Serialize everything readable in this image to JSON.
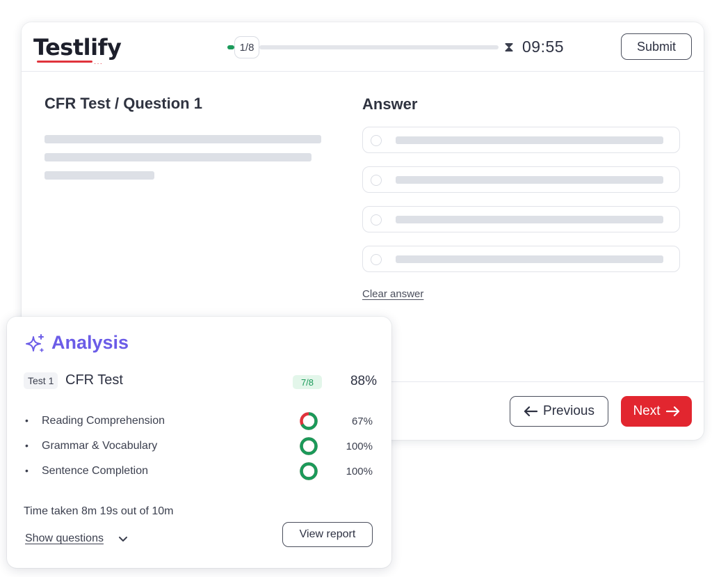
{
  "header": {
    "logo_text": "Testlify",
    "logo_dots": "···",
    "progress_label": "1/8",
    "progress_fraction": 0.0,
    "timer": "09:55",
    "timer_icon": "hourglass-icon",
    "submit_label": "Submit"
  },
  "question": {
    "title": "CFR Test / Question 1"
  },
  "answer": {
    "title": "Answer",
    "option_count": 4,
    "clear_label": "Clear answer"
  },
  "nav": {
    "previous_label": "Previous",
    "next_label": "Next",
    "previous_icon": "arrow-left-icon",
    "next_icon": "arrow-right-icon"
  },
  "analysis": {
    "title": "Analysis",
    "icon": "sparkle-icon",
    "test_tag": "Test 1",
    "test_name": "CFR Test",
    "score_badge": "7/8",
    "score_pct": "88%",
    "sections": [
      {
        "name": "Reading Comprehension",
        "pct_label": "67%",
        "value": 0.67
      },
      {
        "name": "Grammar & Vocabulary",
        "pct_label": "100%",
        "value": 1.0
      },
      {
        "name": "Sentence Completion",
        "pct_label": "100%",
        "value": 1.0
      }
    ],
    "time_taken": "Time taken 8m 19s out of 10m",
    "show_questions_label": "Show questions",
    "view_report_label": "View report"
  },
  "colors": {
    "accent_green": "#1b9a5a",
    "accent_red": "#e2262f",
    "accent_purple": "#6b5ce7",
    "ring_red": "#e0333c"
  }
}
